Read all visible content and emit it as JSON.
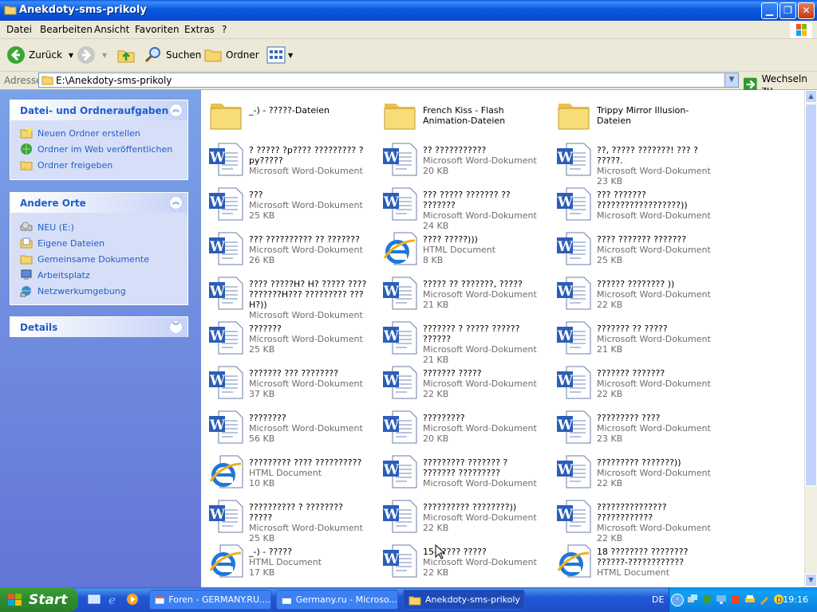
{
  "window": {
    "title": "Anekdoty-sms-prikoly"
  },
  "menu": [
    "Datei",
    "Bearbeiten",
    "Ansicht",
    "Favoriten",
    "Extras",
    "?"
  ],
  "toolbar": {
    "back": "Zurück",
    "search": "Suchen",
    "folders": "Ordner"
  },
  "address": {
    "label": "Adresse",
    "value": "E:\\Anekdoty-sms-prikoly",
    "go": "Wechseln zu"
  },
  "sidebar": {
    "tasks": {
      "title": "Datei- und Ordneraufgaben",
      "items": [
        "Neuen Ordner erstellen",
        "Ordner im Web veröffentlichen",
        "Ordner freigeben"
      ]
    },
    "places": {
      "title": "Andere Orte",
      "items": [
        "NEU (E:)",
        "Eigene Dateien",
        "Gemeinsame Dokumente",
        "Arbeitsplatz",
        "Netzwerkumgebung"
      ]
    },
    "details": {
      "title": "Details"
    }
  },
  "files": [
    {
      "name": "_-) - ?????-Dateien",
      "type": "",
      "size": "",
      "icon": "folder"
    },
    {
      "name": "French Kiss - Flash Animation-Dateien",
      "type": "",
      "size": "",
      "icon": "folder"
    },
    {
      "name": "Trippy Mirror Illusion-Dateien",
      "type": "",
      "size": "",
      "icon": "folder"
    },
    {
      "name": "? ????? ?p???? ????????? ?py?????",
      "type": "Microsoft Word-Dokument",
      "size": "",
      "icon": "word"
    },
    {
      "name": "?? ???????????",
      "type": "Microsoft Word-Dokument",
      "size": "20 KB",
      "icon": "word"
    },
    {
      "name": "??, ????? ???????! ??? ? ?????.",
      "type": "Microsoft Word-Dokument",
      "size": "23 KB",
      "icon": "word"
    },
    {
      "name": "???",
      "type": "Microsoft Word-Dokument",
      "size": "25 KB",
      "icon": "word"
    },
    {
      "name": "??? ????? ??????? ?? ???????",
      "type": "Microsoft Word-Dokument",
      "size": "24 KB",
      "icon": "word"
    },
    {
      "name": "??? ??????? ??????????????????))",
      "type": "Microsoft Word-Dokument",
      "size": "",
      "icon": "word"
    },
    {
      "name": "??? ?????????? ?? ???????",
      "type": "Microsoft Word-Dokument",
      "size": "26 KB",
      "icon": "word"
    },
    {
      "name": "???? ?????)))",
      "type": "HTML Document",
      "size": "8 KB",
      "icon": "ie"
    },
    {
      "name": "???? ??????? ???????",
      "type": "Microsoft Word-Dokument",
      "size": "25 KB",
      "icon": "word"
    },
    {
      "name": "???? ?????H? H? ????? ???? ???????H??? ????????? ???H?))",
      "type": "Microsoft Word-Dokument",
      "size": "",
      "icon": "word"
    },
    {
      "name": "????? ?? ???????, ?????",
      "type": "Microsoft Word-Dokument",
      "size": "21 KB",
      "icon": "word"
    },
    {
      "name": "?????? ???????? ))",
      "type": "Microsoft Word-Dokument",
      "size": "22 KB",
      "icon": "word"
    },
    {
      "name": "???????",
      "type": "Microsoft Word-Dokument",
      "size": "25 KB",
      "icon": "word"
    },
    {
      "name": "??????? ? ????? ?????? ??????",
      "type": "Microsoft Word-Dokument",
      "size": "21 KB",
      "icon": "word"
    },
    {
      "name": "??????? ?? ?????",
      "type": "Microsoft Word-Dokument",
      "size": "21 KB",
      "icon": "word"
    },
    {
      "name": "??????? ??? ????????",
      "type": "Microsoft Word-Dokument",
      "size": "37 KB",
      "icon": "word"
    },
    {
      "name": "??????? ?????",
      "type": "Microsoft Word-Dokument",
      "size": "22 KB",
      "icon": "word"
    },
    {
      "name": "??????? ???????",
      "type": "Microsoft Word-Dokument",
      "size": "22 KB",
      "icon": "word"
    },
    {
      "name": "????????",
      "type": "Microsoft Word-Dokument",
      "size": "56 KB",
      "icon": "word"
    },
    {
      "name": "?????????",
      "type": "Microsoft Word-Dokument",
      "size": "20 KB",
      "icon": "word"
    },
    {
      "name": "????????? ????",
      "type": "Microsoft Word-Dokument",
      "size": "23 KB",
      "icon": "word"
    },
    {
      "name": "????????? ???? ??????????",
      "type": "HTML Document",
      "size": "10 KB",
      "icon": "ie"
    },
    {
      "name": "????????? ??????? ? ??????? ?????????",
      "type": "Microsoft Word-Dokument",
      "size": "",
      "icon": "word"
    },
    {
      "name": "????????? ???????))",
      "type": "Microsoft Word-Dokument",
      "size": "22 KB",
      "icon": "word"
    },
    {
      "name": "?????????? ? ???????? ?????",
      "type": "Microsoft Word-Dokument",
      "size": "25 KB",
      "icon": "word"
    },
    {
      "name": "?????????? ????????))",
      "type": "Microsoft Word-Dokument",
      "size": "22 KB",
      "icon": "word"
    },
    {
      "name": "??????????????? ????????????",
      "type": "Microsoft Word-Dokument",
      "size": "22 KB",
      "icon": "word"
    },
    {
      "name": "_-) - ?????",
      "type": "HTML Document",
      "size": "17 KB",
      "icon": "ie"
    },
    {
      "name": "15-????? ?????",
      "type": "Microsoft Word-Dokument",
      "size": "22 KB",
      "icon": "word"
    },
    {
      "name": "18 ???????? ???????? ??????-????????????",
      "type": "HTML Document",
      "size": "",
      "icon": "ie"
    }
  ],
  "taskbar": {
    "start": "Start",
    "tasks": [
      "Foren - GERMANY.RU....",
      "Germany.ru - Microso...",
      "Anekdoty-sms-prikoly"
    ],
    "lang": "DE",
    "clock": "19:16"
  },
  "colors": {
    "title_blue": "#0a5ae0",
    "sidebar_blue": "#6f8be0",
    "start_green": "#3c9f3c"
  }
}
